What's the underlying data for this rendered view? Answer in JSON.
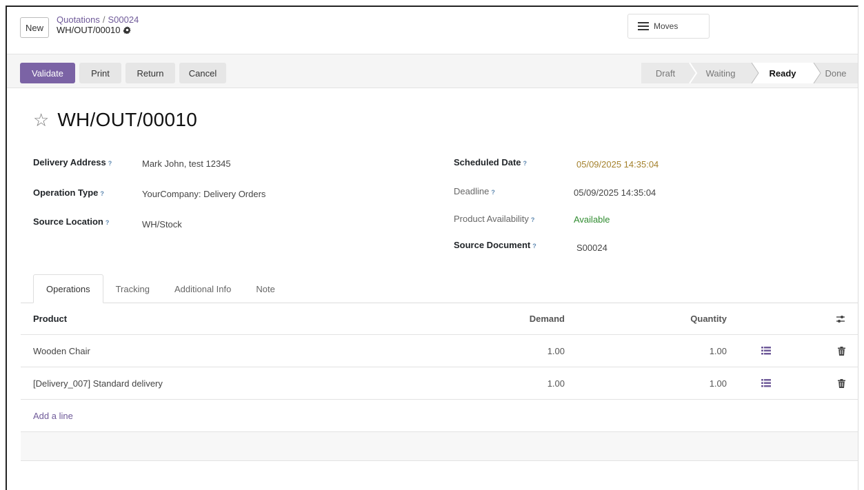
{
  "topbar": {
    "new_label": "New",
    "breadcrumb_parent": "Quotations",
    "breadcrumb_sep": "/",
    "breadcrumb_order": "S00024",
    "breadcrumb_current": "WH/OUT/00010",
    "moves_label": "Moves"
  },
  "actions": {
    "validate": "Validate",
    "print": "Print",
    "return": "Return",
    "cancel": "Cancel"
  },
  "status": {
    "stages": [
      "Draft",
      "Waiting",
      "Ready",
      "Done"
    ],
    "current": "Ready"
  },
  "record": {
    "name": "WH/OUT/00010",
    "delivery_address_label": "Delivery Address",
    "delivery_address": "Mark John, test 12345",
    "operation_type_label": "Operation Type",
    "operation_type": "YourCompany: Delivery Orders",
    "source_location_label": "Source Location",
    "source_location": "WH/Stock",
    "scheduled_date_label": "Scheduled Date",
    "scheduled_date": "05/09/2025 14:35:04",
    "deadline_label": "Deadline",
    "deadline": "05/09/2025 14:35:04",
    "availability_label": "Product Availability",
    "availability": "Available",
    "source_document_label": "Source Document",
    "source_document": "S00024",
    "help_mark": "?"
  },
  "tabs": [
    "Operations",
    "Tracking",
    "Additional Info",
    "Note"
  ],
  "table": {
    "headers": {
      "product": "Product",
      "demand": "Demand",
      "quantity": "Quantity"
    },
    "rows": [
      {
        "product": "Wooden Chair",
        "demand": "1.00",
        "quantity": "1.00"
      },
      {
        "product": "[Delivery_007] Standard delivery",
        "demand": "1.00",
        "quantity": "1.00"
      }
    ],
    "add_line": "Add a line"
  },
  "colors": {
    "primary": "#7b63a5",
    "link": "#6f5a99",
    "warning": "#a4812c",
    "success": "#2f8b2f"
  },
  "icons": [
    "gear-icon",
    "hamburger-icon",
    "star-icon",
    "help-icon",
    "optional-columns-icon",
    "detailed-operations-icon",
    "trash-icon"
  ]
}
